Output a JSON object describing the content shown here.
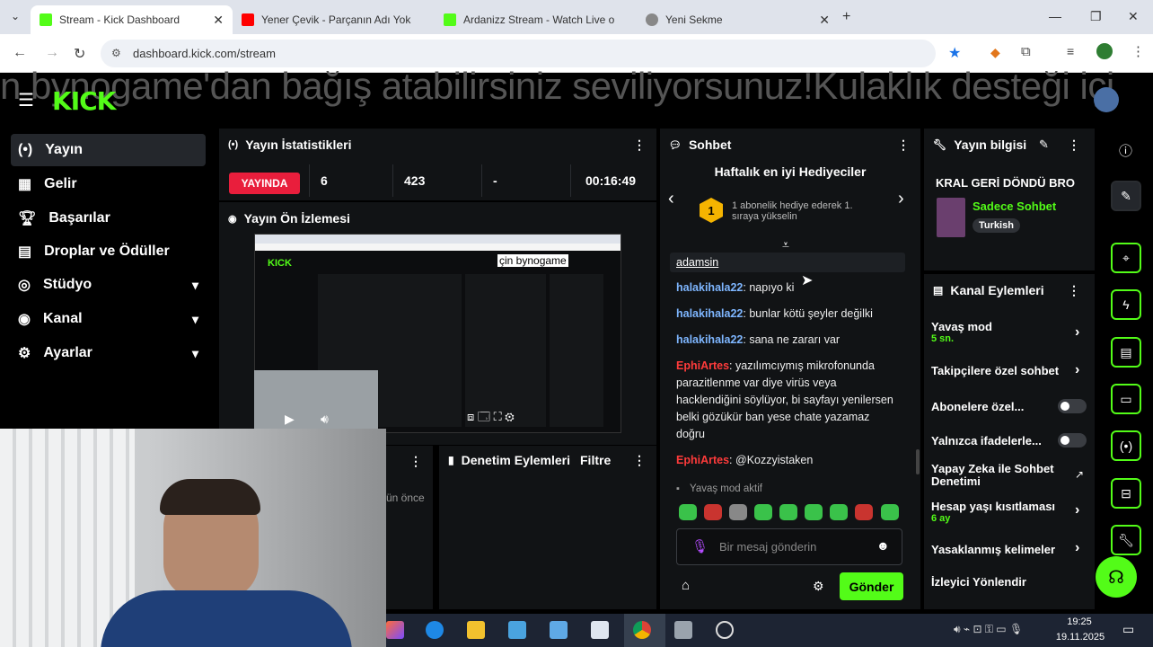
{
  "browser": {
    "tabs": [
      {
        "label": "Stream - Kick Dashboard",
        "active": true,
        "icon": "kick-icon",
        "color": "#53fc18"
      },
      {
        "label": "Yener Çevik - Parçanın Adı Yok |",
        "active": false,
        "icon": "youtube-icon",
        "color": "#ff0000"
      },
      {
        "label": "Ardanizz Stream - Watch Live o",
        "active": false,
        "icon": "kick-icon",
        "color": "#53fc18"
      },
      {
        "label": "Yeni Sekme",
        "active": false,
        "icon": "chrome-icon",
        "color": "#888888"
      }
    ],
    "url": "dashboard.kick.com/stream"
  },
  "marquee": "n bynogame'dan bağış atabilirsiniz seviliyorsunuz!Kulaklık desteği içi",
  "logo": "KICK",
  "sidebar": {
    "items": [
      {
        "label": "Yayın",
        "icon": "broadcast-icon",
        "active": true
      },
      {
        "label": "Gelir",
        "icon": "revenue-icon"
      },
      {
        "label": "Başarılar",
        "icon": "trophy-icon"
      },
      {
        "label": "Droplar ve Ödüller",
        "icon": "drops-icon"
      },
      {
        "label": "Stüdyo",
        "icon": "studio-icon",
        "expandable": true
      },
      {
        "label": "Kanal",
        "icon": "channel-icon",
        "expandable": true
      },
      {
        "label": "Ayarlar",
        "icon": "settings-icon",
        "expandable": true
      }
    ]
  },
  "stats": {
    "title": "Yayın İstatistikleri",
    "live_badge": "YAYINDA",
    "viewers": "6",
    "followers": "423",
    "dash": "-",
    "uptime": "00:16:49"
  },
  "preview": {
    "title": "Yayın Ön İzlemesi",
    "overlay_text": "çin bynogame"
  },
  "lower_panels": {
    "activity_time": "ün önce",
    "moderation_title": "Denetim Eylemleri",
    "filter_label": "Filtre"
  },
  "chat": {
    "title": "Sohbet",
    "gifters_title": "Haftalık en iyi Hediyeciler",
    "gifters_text": "1 abonelik hediye ederek 1. sıraya yükselin",
    "rank": "1",
    "pinned_user": "adamsin",
    "messages": [
      {
        "user": "halakihala22",
        "text": " napıyo ki",
        "color": "#7eb6ff"
      },
      {
        "user": "halakihala22",
        "text": " bunlar kötü şeyler değilki",
        "color": "#7eb6ff"
      },
      {
        "user": "halakihala22",
        "text": " sana ne zararı var",
        "color": "#7eb6ff"
      },
      {
        "user": "EphiArtes",
        "text": " yazılımcıymış mikrofonunda parazitlenme var diye virüs veya hacklendiğini söylüyor, bi sayfayı yenilersen belki gözükür ban yese chate yazamaz doğru",
        "color": "#ff3b3b"
      },
      {
        "user": "EphiArtes",
        "text": " @Kozzyistaken",
        "color": "#ff3b3b"
      }
    ],
    "slow_mode_notice": "Yavaş mod aktif",
    "input_placeholder": "Bir mesaj gönderin",
    "send_label": "Gönder"
  },
  "stream_info": {
    "title": "Yayın bilgisi",
    "stream_title": "KRAL GERİ DÖNDÜ BRO",
    "category": "Sadece Sohbet",
    "language": "Turkish"
  },
  "channel_actions": {
    "title": "Kanal Eylemleri",
    "items": [
      {
        "label": "Yavaş mod",
        "sub": "5 sn.",
        "control": "chevron"
      },
      {
        "label": "Takipçilere özel sohbet",
        "control": "chevron"
      },
      {
        "label": "Abonelere özel...",
        "control": "toggle"
      },
      {
        "label": "Yalnızca ifadelerle...",
        "control": "toggle"
      },
      {
        "label": "Yapay Zeka ile Sohbet Denetimi",
        "control": "external"
      },
      {
        "label": "Hesap yaşı kısıtlaması",
        "sub": "6 ay",
        "control": "chevron"
      },
      {
        "label": "Yasaklanmış kelimeler",
        "control": "chevron"
      },
      {
        "label": "İzleyici Yönlendir",
        "control": "none"
      }
    ]
  },
  "taskbar": {
    "time": "19:25",
    "date": "19.11.2025"
  },
  "colors": {
    "accent": "#53fc18",
    "live": "#e91e3c",
    "panel": "#111315",
    "background": "#000000"
  }
}
